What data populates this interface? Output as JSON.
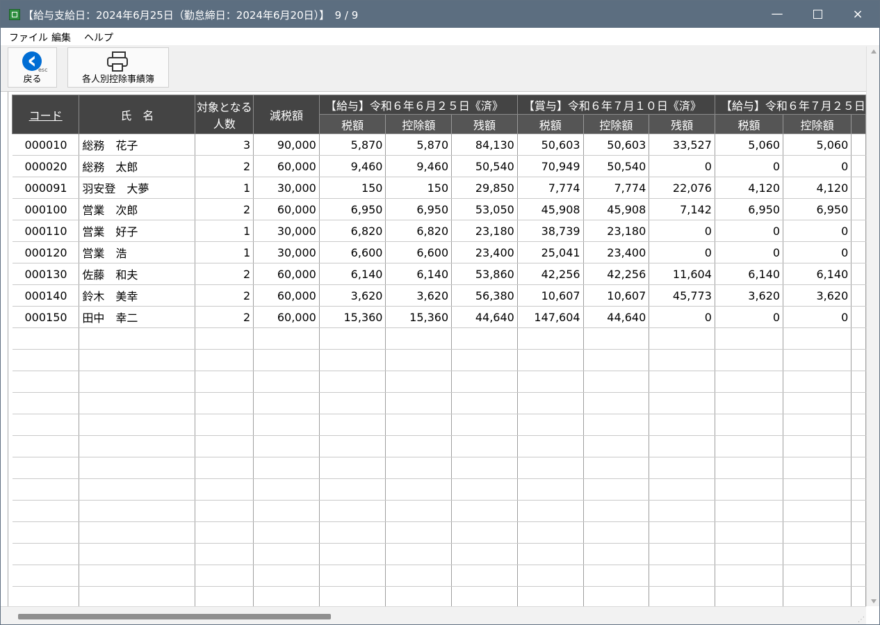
{
  "window": {
    "title": "【給与支給日：2024年6月25日（勤怠締日：2024年6月20日）】　9 / 9",
    "minimize": "—",
    "close": "×"
  },
  "menu": {
    "file": "ファイル",
    "edit": "編集",
    "help": "ヘルプ"
  },
  "toolbar": {
    "back": "戻る",
    "esc": "esc",
    "ledger": "各人別控除事績簿"
  },
  "table": {
    "headers": {
      "code": "コード",
      "name": "氏　名",
      "count_line1": "対象となる",
      "count_line2": "人数",
      "reduction": "減税額",
      "group1": "【給与】令和６年６月２５日《済》",
      "group2": "【賞与】令和６年７月１０日《済》",
      "group3": "【給与】令和６年７月２５日",
      "tax": "税額",
      "deduction": "控除額",
      "remaining": "残額"
    },
    "rows": [
      {
        "code": "000010",
        "name": "総務　花子",
        "count": "3",
        "reduction": "90,000",
        "g1_tax": "5,870",
        "g1_ded": "5,870",
        "g1_rem": "84,130",
        "g2_tax": "50,603",
        "g2_ded": "50,603",
        "g2_rem": "33,527",
        "g3_tax": "5,060",
        "g3_ded": "5,060"
      },
      {
        "code": "000020",
        "name": "総務　太郎",
        "count": "2",
        "reduction": "60,000",
        "g1_tax": "9,460",
        "g1_ded": "9,460",
        "g1_rem": "50,540",
        "g2_tax": "70,949",
        "g2_ded": "50,540",
        "g2_rem": "0",
        "g3_tax": "0",
        "g3_ded": "0"
      },
      {
        "code": "000091",
        "name": "羽安登　大夢",
        "count": "1",
        "reduction": "30,000",
        "g1_tax": "150",
        "g1_ded": "150",
        "g1_rem": "29,850",
        "g2_tax": "7,774",
        "g2_ded": "7,774",
        "g2_rem": "22,076",
        "g3_tax": "4,120",
        "g3_ded": "4,120"
      },
      {
        "code": "000100",
        "name": "営業　次郎",
        "count": "2",
        "reduction": "60,000",
        "g1_tax": "6,950",
        "g1_ded": "6,950",
        "g1_rem": "53,050",
        "g2_tax": "45,908",
        "g2_ded": "45,908",
        "g2_rem": "7,142",
        "g3_tax": "6,950",
        "g3_ded": "6,950"
      },
      {
        "code": "000110",
        "name": "営業　好子",
        "count": "1",
        "reduction": "30,000",
        "g1_tax": "6,820",
        "g1_ded": "6,820",
        "g1_rem": "23,180",
        "g2_tax": "38,739",
        "g2_ded": "23,180",
        "g2_rem": "0",
        "g3_tax": "0",
        "g3_ded": "0"
      },
      {
        "code": "000120",
        "name": "営業　浩",
        "count": "1",
        "reduction": "30,000",
        "g1_tax": "6,600",
        "g1_ded": "6,600",
        "g1_rem": "23,400",
        "g2_tax": "25,041",
        "g2_ded": "23,400",
        "g2_rem": "0",
        "g3_tax": "0",
        "g3_ded": "0"
      },
      {
        "code": "000130",
        "name": "佐藤　和夫",
        "count": "2",
        "reduction": "60,000",
        "g1_tax": "6,140",
        "g1_ded": "6,140",
        "g1_rem": "53,860",
        "g2_tax": "42,256",
        "g2_ded": "42,256",
        "g2_rem": "11,604",
        "g3_tax": "6,140",
        "g3_ded": "6,140"
      },
      {
        "code": "000140",
        "name": "鈴木　美幸",
        "count": "2",
        "reduction": "60,000",
        "g1_tax": "3,620",
        "g1_ded": "3,620",
        "g1_rem": "56,380",
        "g2_tax": "10,607",
        "g2_ded": "10,607",
        "g2_rem": "45,773",
        "g3_tax": "3,620",
        "g3_ded": "3,620"
      },
      {
        "code": "000150",
        "name": "田中　幸二",
        "count": "2",
        "reduction": "60,000",
        "g1_tax": "15,360",
        "g1_ded": "15,360",
        "g1_rem": "44,640",
        "g2_tax": "147,604",
        "g2_ded": "44,640",
        "g2_rem": "0",
        "g3_tax": "0",
        "g3_ded": "0"
      }
    ]
  },
  "colors": {
    "title_bar": "#5c6e80",
    "header_bg": "#444444",
    "back_button": "#006dd4"
  },
  "icons": {
    "app": "spreadsheet-icon",
    "back": "back-arrow-icon",
    "ledger": "printer-icon"
  }
}
